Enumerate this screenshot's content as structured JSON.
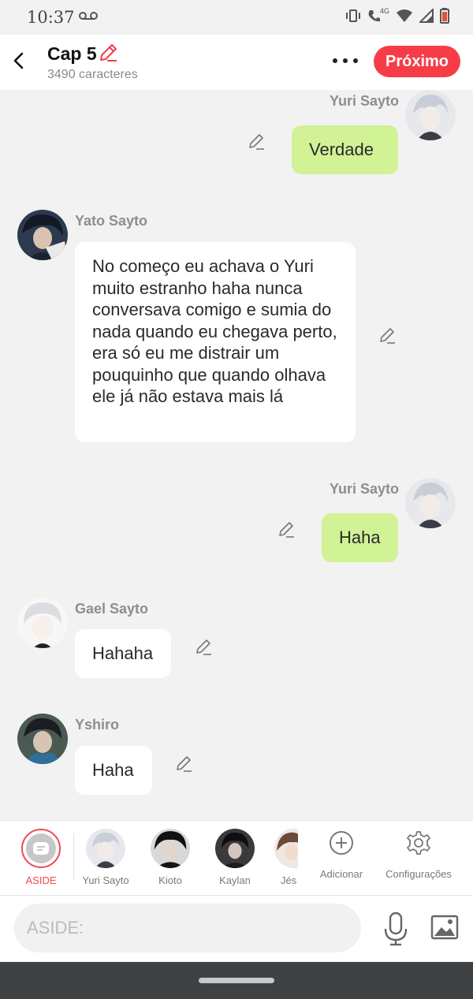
{
  "status": {
    "time": "10:37",
    "network": "4G"
  },
  "header": {
    "title": "Cap 5",
    "subtitle": "3490 caracteres",
    "next_label": "Próximo"
  },
  "messages": [
    {
      "sender": "Yuri Sayto",
      "side": "right",
      "text": "Verdade"
    },
    {
      "sender": "Yato Sayto",
      "side": "left",
      "text": "No começo eu achava o Yuri muito estranho haha nunca conversava comigo e sumia do nada quando eu chegava perto, era só eu me distrair um pouquinho que quando olhava ele já não estava mais lá"
    },
    {
      "sender": "Yuri Sayto",
      "side": "right",
      "text": "Haha"
    },
    {
      "sender": "Gael Sayto",
      "side": "left",
      "text": "Hahaha"
    },
    {
      "sender": "Yshiro",
      "side": "left",
      "text": "Haha"
    }
  ],
  "characters": [
    {
      "label": "ASIDE",
      "active": true
    },
    {
      "label": "Yuri Sayto"
    },
    {
      "label": "Kioto"
    },
    {
      "label": "Kaylan"
    },
    {
      "label": "Jés"
    }
  ],
  "tools": {
    "add_label": "Adicionar",
    "settings_label": "Configurações"
  },
  "input": {
    "placeholder": "ASIDE:"
  },
  "colors": {
    "accent": "#f63d47",
    "my_bubble": "#d2f296",
    "other_bubble": "#ffffff"
  }
}
